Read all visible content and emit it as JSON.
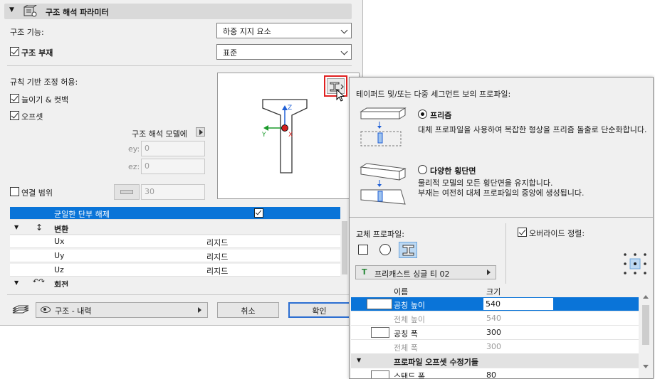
{
  "section": {
    "title": "구조 해석 파라미터"
  },
  "structural_function": {
    "label": "구조 기능:",
    "value": "하중 지지 요소"
  },
  "structural_member": {
    "label": "구조 부재",
    "checked": true,
    "value": "표준"
  },
  "rule_based": {
    "label": "규칙 기반 조정 허용:",
    "extend_cut": {
      "label": "늘이기 & 컷백",
      "checked": true
    },
    "offset": {
      "label": "오프셋",
      "checked": true
    }
  },
  "analytic_model": {
    "label": "구조 해석 모델에",
    "ey_label": "ey:",
    "ey_value": "0",
    "ez_label": "ez:",
    "ez_value": "0"
  },
  "connection_range": {
    "label": "연결 범위",
    "checked": false,
    "value": "30"
  },
  "release_table": {
    "uniform_release": {
      "label": "균일한 단부 해제",
      "checked": true
    },
    "translation": {
      "label": "변환"
    },
    "rows": [
      {
        "name": "Ux",
        "value": "리지드"
      },
      {
        "name": "Uy",
        "value": "리지드"
      },
      {
        "name": "Uz",
        "value": "리지드"
      }
    ],
    "rotation": {
      "label": "회전"
    }
  },
  "footer": {
    "layer": "구조 - 내력",
    "cancel": "취소",
    "ok": "확인"
  },
  "popup": {
    "title": "테이퍼드 및/또는 다중 세그먼트 보의 프로파일:",
    "prism": {
      "label": "프리즘",
      "selected": true,
      "desc": "대체 프로파일을 사용하여 복잡한 형상을 프리즘 돌출로 단순화합니다."
    },
    "varied": {
      "label": "다양한 횡단면",
      "selected": false,
      "desc1": "물리적 모델의 모든 횡단면을 유지합니다.",
      "desc2": "부재는 여전히 대체 프로파일의 중앙에 생성됩니다."
    },
    "replacement_label": "교체 프로파일:",
    "override": {
      "label": "오버라이드 정렬:",
      "checked": true
    },
    "profile_value": "프리캐스트 싱글 티 02",
    "columns": {
      "name": "이름",
      "size": "크기"
    },
    "rows": [
      {
        "name": "공칭 높이",
        "value": "540",
        "selected": true,
        "dim": false
      },
      {
        "name": "전체 높이",
        "value": "540",
        "selected": false,
        "dim": true
      },
      {
        "name": "공칭 폭",
        "value": "300",
        "selected": false,
        "dim": false
      },
      {
        "name": "전체 폭",
        "value": "300",
        "selected": false,
        "dim": true
      }
    ],
    "group": {
      "label": "프로파일 오프셋 수정기들"
    },
    "last_row": {
      "name": "스탠드 폭",
      "value": "80"
    }
  },
  "colors": {
    "selection": "#0a74d8",
    "highlight_box": "#e02020",
    "axis_z": "#1f5fd6",
    "axis_y": "#1a9a2a",
    "axis_x": "#e03030"
  },
  "icons": [
    "structure-settings-icon",
    "profile-type-button-icon",
    "cursor-icon",
    "link-icon",
    "eye-icon",
    "layers-icon"
  ]
}
